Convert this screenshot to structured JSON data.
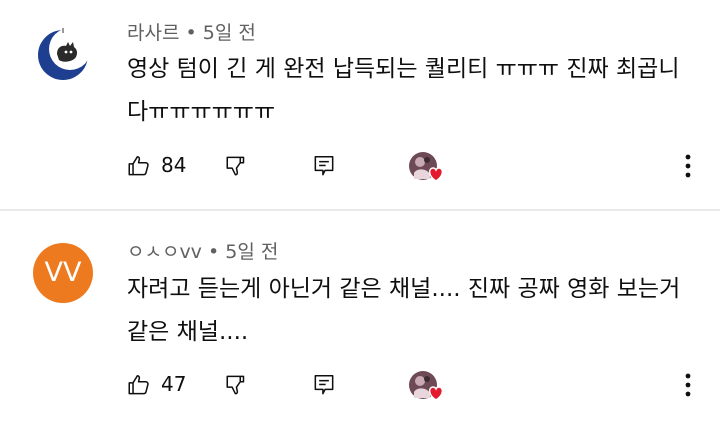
{
  "comments": [
    {
      "author": "라사르",
      "separator": "•",
      "time": "5일 전",
      "text": "영상 텀이 긴 게 완전 납득되는 퀄리티 ㅠㅠㅠ 진짜 최곱니다ㅠㅠㅠㅠㅠㅠ",
      "likes": "84",
      "avatar_icon": "crescent-moon-cat-icon",
      "avatar_color": "#1e3f8f"
    },
    {
      "author": "ㅇㅅㅇvv",
      "separator": "•",
      "time": "5일 전",
      "text": "자려고 듣는게 아닌거 같은 채널.... 진짜 공짜 영화 보는거 같은 채널....",
      "likes": "47",
      "avatar_letters": "VV",
      "avatar_color": "#ee7a1f"
    }
  ],
  "icons": {
    "like": "thumbs-up-icon",
    "dislike": "thumbs-down-icon",
    "reply": "reply-icon",
    "creator_heart": "creator-heart-icon",
    "more": "more-vert-icon"
  },
  "colors": {
    "heart": "#e3192d",
    "meta_text": "#606060",
    "divider": "#e9e9e9"
  }
}
